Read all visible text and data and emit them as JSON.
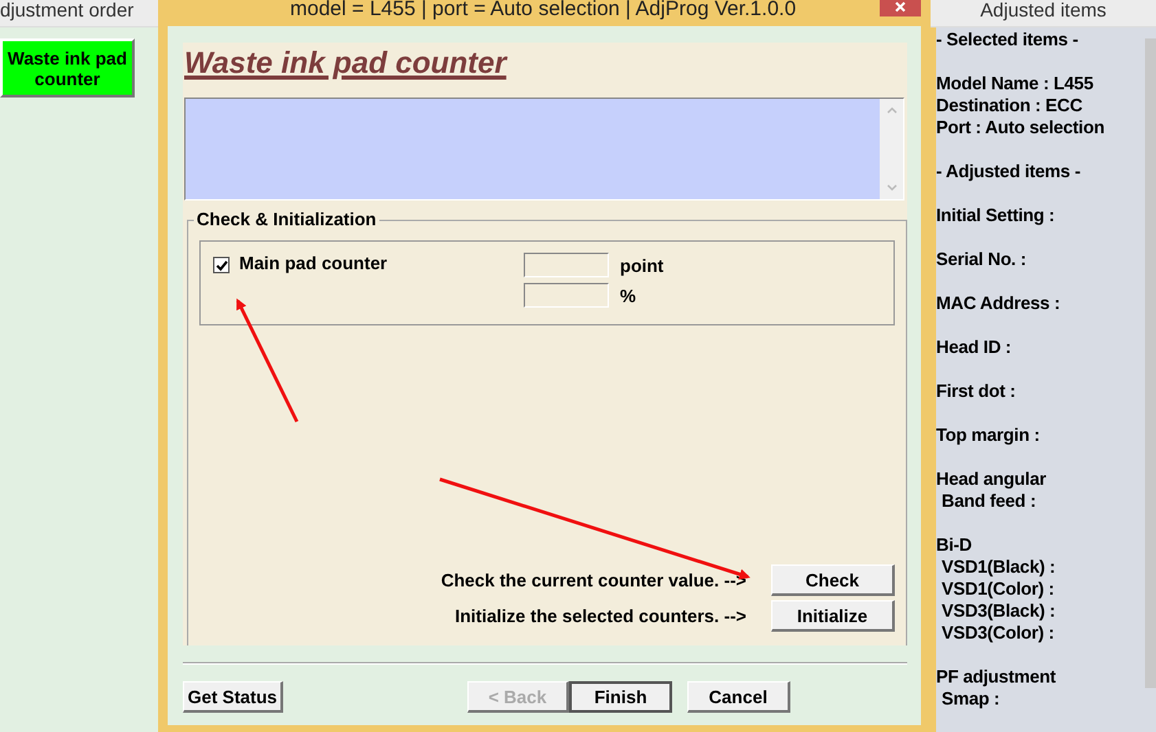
{
  "left_panel": {
    "title": "djustment order",
    "items": [
      {
        "label": "Waste ink pad counter",
        "selected": true
      }
    ]
  },
  "window": {
    "title": "model = L455 | port = Auto selection | AdjProg Ver.1.0.0",
    "heading": "Waste ink pad counter",
    "group": {
      "title": "Check & Initialization",
      "counters": [
        {
          "label": "Main pad counter",
          "checked": true,
          "fields": [
            {
              "unit": "point"
            },
            {
              "unit": "%"
            }
          ]
        }
      ],
      "actions": [
        {
          "text": "Check the current counter value. -->",
          "button": "Check"
        },
        {
          "text": "Initialize the selected counters. -->",
          "button": "Initialize"
        }
      ]
    },
    "buttons": [
      {
        "label": "Get Status",
        "disabled": false
      },
      {
        "label": "< Back",
        "disabled": true
      },
      {
        "label": "Finish",
        "disabled": false
      },
      {
        "label": "Cancel",
        "disabled": false
      }
    ]
  },
  "right_panel": {
    "title": "Adjusted items",
    "sections": [
      {
        "lines": [
          {
            "text": "- Selected items -"
          }
        ]
      },
      {
        "lines": [
          {
            "text": "Model Name : L455"
          },
          {
            "text": "Destination : ECC"
          },
          {
            "text": "Port : Auto selection"
          }
        ]
      },
      {
        "lines": [
          {
            "text": "- Adjusted items -"
          }
        ]
      },
      {
        "lines": [
          {
            "text": "Initial Setting :"
          }
        ]
      },
      {
        "lines": [
          {
            "text": "Serial No. :"
          }
        ]
      },
      {
        "lines": [
          {
            "text": "MAC Address :"
          }
        ]
      },
      {
        "lines": [
          {
            "text": "Head ID :"
          }
        ]
      },
      {
        "lines": [
          {
            "text": "First dot :"
          }
        ]
      },
      {
        "lines": [
          {
            "text": "Top margin :"
          }
        ]
      },
      {
        "lines": [
          {
            "text": "Head angular",
            "children": [
              {
                "text": "Band feed :"
              }
            ]
          }
        ]
      },
      {
        "lines": [
          {
            "text": "Bi-D",
            "children": [
              {
                "text": "VSD1(Black) :"
              },
              {
                "text": "VSD1(Color) :"
              },
              {
                "text": "VSD3(Black) :"
              },
              {
                "text": "VSD3(Color) :"
              }
            ]
          }
        ]
      },
      {
        "lines": [
          {
            "text": "PF adjustment",
            "children": [
              {
                "text": "Smap :"
              }
            ]
          }
        ]
      }
    ]
  }
}
